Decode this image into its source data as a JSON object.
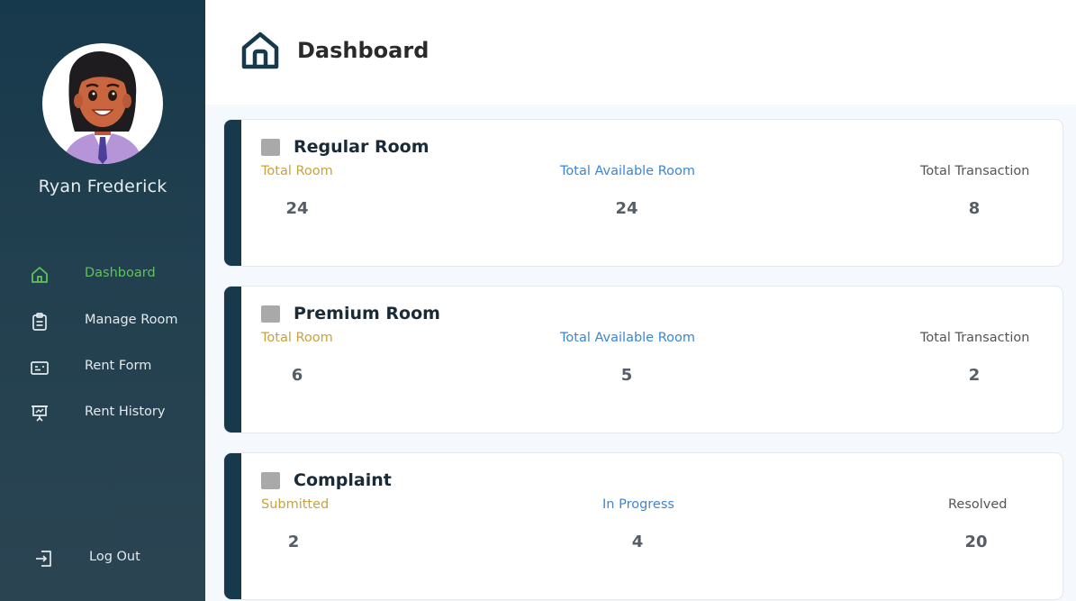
{
  "user": {
    "name": "Ryan Frederick"
  },
  "nav": {
    "items": [
      {
        "label": "Dashboard",
        "icon": "home-icon",
        "active": true
      },
      {
        "label": "Manage Room",
        "icon": "clipboard-icon",
        "active": false
      },
      {
        "label": "Rent Form",
        "icon": "id-card-icon",
        "active": false
      },
      {
        "label": "Rent History",
        "icon": "presentation-icon",
        "active": false
      }
    ],
    "logout": {
      "label": "Log Out",
      "icon": "logout-icon"
    }
  },
  "header": {
    "title": "Dashboard",
    "icon": "home-icon"
  },
  "cards": [
    {
      "title": "Regular Room",
      "stats": [
        {
          "label": "Total Room",
          "value": "24"
        },
        {
          "label": "Total Available Room",
          "value": "24"
        },
        {
          "label": "Total Transaction",
          "value": "8"
        }
      ]
    },
    {
      "title": "Premium Room",
      "stats": [
        {
          "label": "Total Room",
          "value": "6"
        },
        {
          "label": "Total Available Room",
          "value": "5"
        },
        {
          "label": "Total Transaction",
          "value": "2"
        }
      ]
    },
    {
      "title": "Complaint",
      "stats": [
        {
          "label": "Submitted",
          "value": "2"
        },
        {
          "label": "In Progress",
          "value": "4"
        },
        {
          "label": "Resolved",
          "value": "20"
        }
      ]
    }
  ],
  "colors": {
    "sidebar": "#17394c",
    "active_nav": "#5fc25b",
    "label_first": "#c9a23b",
    "label_second": "#3b86d4",
    "label_third": "#555555"
  }
}
